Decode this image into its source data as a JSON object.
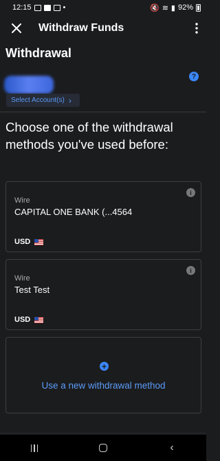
{
  "status_bar": {
    "time": "12:15",
    "battery": "92%",
    "icons": [
      "gallery-icon",
      "image-icon",
      "image-icon",
      "dot-icon",
      "mute-icon",
      "wifi-icon",
      "signal-icon",
      "battery-icon"
    ]
  },
  "header": {
    "title": "Withdraw Funds",
    "close_icon": "close-icon",
    "more_icon": "more-vertical-icon"
  },
  "section": {
    "title": "Withdrawal",
    "help_glyph": "?"
  },
  "account": {
    "select_label": "Select Account(s)",
    "chevron": "›"
  },
  "prompt": "Choose one of the withdrawal methods you've used before:",
  "methods": [
    {
      "type": "Wire",
      "name": "CAPITAL ONE BANK (...4564",
      "currency": "USD",
      "info_glyph": "i"
    },
    {
      "type": "Wire",
      "name": "Test Test",
      "currency": "USD",
      "info_glyph": "i"
    }
  ],
  "new_method": {
    "label": "Use a new withdrawal method",
    "plus_glyph": "+"
  },
  "nav": {
    "back_glyph": "‹"
  },
  "colors": {
    "background": "#1b1c1e",
    "accent": "#3b86f7",
    "link": "#5b9af7",
    "card_border": "#3e3f42"
  }
}
